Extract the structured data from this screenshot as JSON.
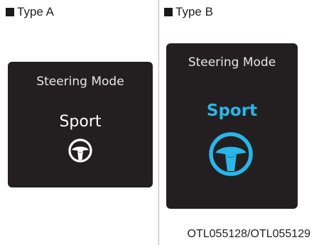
{
  "type_a": {
    "label": "Type A",
    "panel_title": "Steering Mode",
    "mode": "Sport",
    "icon": "steering-wheel-icon",
    "icon_color": "#ffffff",
    "mode_color": "#ffffff"
  },
  "type_b": {
    "label": "Type B",
    "panel_title": "Steering Mode",
    "mode": "Sport",
    "icon": "steering-wheel-icon",
    "icon_color": "#29b6ea",
    "mode_color": "#29b6ea"
  },
  "caption": "OTL055128/OTL055129",
  "colors": {
    "panel_background": "#231f20",
    "divider": "#b8b8b8"
  }
}
